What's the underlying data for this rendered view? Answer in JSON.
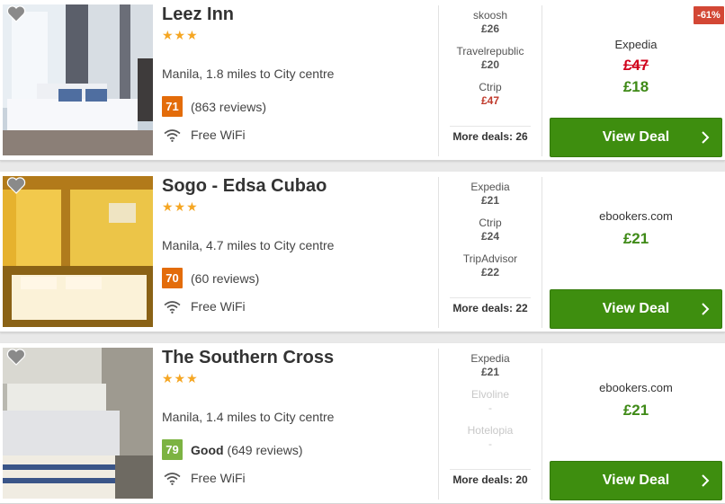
{
  "hotels": [
    {
      "name": "Leez Inn",
      "stars": "★★★",
      "location": "Manila, 1.8 miles to City centre",
      "score": "71",
      "score_word": "",
      "score_color": "#e36c0a",
      "reviews": "(863 reviews)",
      "amenity": "Free WiFi",
      "deals": [
        {
          "provider": "skoosh",
          "price": "£26"
        },
        {
          "provider": "Travelrepublic",
          "price": "£20"
        },
        {
          "provider": "Ctrip",
          "price": "£47"
        }
      ],
      "more_deals": "More deals: 26",
      "best_provider": "Expedia",
      "old_price": "£47",
      "best_price": "£18",
      "discount": "-61%",
      "cta": "View Deal"
    },
    {
      "name": "Sogo - Edsa Cubao",
      "stars": "★★★",
      "location": "Manila, 4.7 miles to City centre",
      "score": "70",
      "score_word": "",
      "score_color": "#e36c0a",
      "reviews": "(60 reviews)",
      "amenity": "Free WiFi",
      "deals": [
        {
          "provider": "Expedia",
          "price": "£21"
        },
        {
          "provider": "Ctrip",
          "price": "£24"
        },
        {
          "provider": "TripAdvisor",
          "price": "£22"
        }
      ],
      "more_deals": "More deals: 22",
      "best_provider": "ebookers.com",
      "old_price": "",
      "best_price": "£21",
      "discount": "",
      "cta": "View Deal"
    },
    {
      "name": "The Southern Cross",
      "stars": "★★★",
      "location": "Manila, 1.4 miles to City centre",
      "score": "79",
      "score_word": "Good",
      "score_color": "#7cb342",
      "reviews": "(649 reviews)",
      "amenity": "Free WiFi",
      "deals": [
        {
          "provider": "Expedia",
          "price": "£21"
        },
        {
          "provider": "Elvoline",
          "price": "-"
        },
        {
          "provider": "Hotelopia",
          "price": "-"
        }
      ],
      "more_deals": "More deals: 20",
      "best_provider": "ebookers.com",
      "old_price": "",
      "best_price": "£21",
      "discount": "",
      "cta": "View Deal"
    }
  ],
  "colors": {
    "ctrip_price_highlight": "#c0392b",
    "button_green": "#3e8e0f",
    "price_green": "#3f8a17",
    "star_gold": "#f5a623"
  },
  "icons": {
    "favorite": "heart-icon",
    "wifi": "wifi-icon",
    "chevron": "chevron-right-icon"
  }
}
